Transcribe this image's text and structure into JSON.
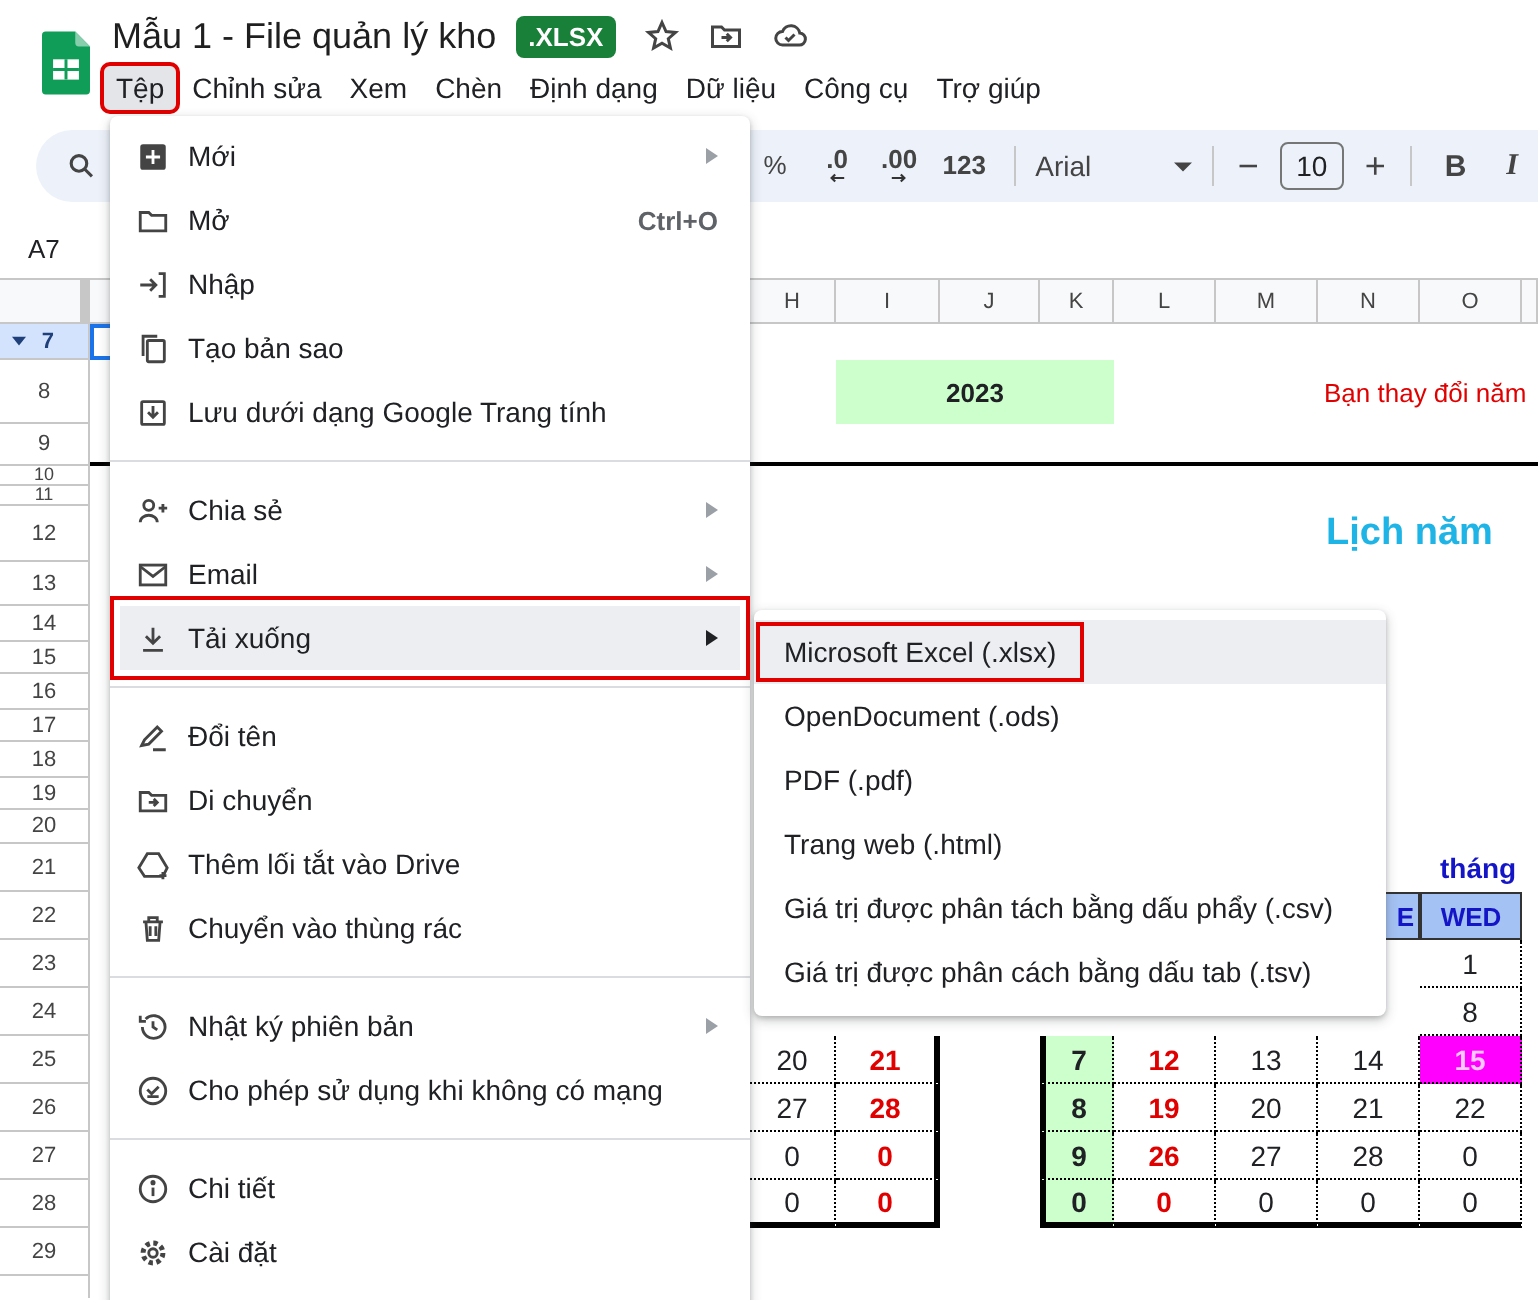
{
  "document": {
    "title": "Mẫu 1 - File quản lý kho",
    "badge": ".XLSX"
  },
  "menu_bar": [
    {
      "label": "Tệp",
      "selected": true,
      "annotated": true
    },
    {
      "label": "Chỉnh sửa",
      "selected": false,
      "annotated": false
    },
    {
      "label": "Xem",
      "selected": false,
      "annotated": false
    },
    {
      "label": "Chèn",
      "selected": false,
      "annotated": false
    },
    {
      "label": "Định dạng",
      "selected": false,
      "annotated": false
    },
    {
      "label": "Dữ liệu",
      "selected": false,
      "annotated": false
    },
    {
      "label": "Công cụ",
      "selected": false,
      "annotated": false
    },
    {
      "label": "Trợ giúp",
      "selected": false,
      "annotated": false
    }
  ],
  "toolbar": {
    "format_buttons": [
      "%",
      ".0",
      ".00",
      "123"
    ],
    "font": "Arial",
    "decrease": "−",
    "font_size": "10",
    "increase": "+",
    "style_buttons": [
      "B",
      "I"
    ]
  },
  "name_box": "A7",
  "sheet": {
    "columns": [
      "H",
      "I",
      "J",
      "K",
      "L",
      "M",
      "N",
      "O"
    ],
    "rows": [
      {
        "number": "7",
        "selected": true
      },
      {
        "number": "8",
        "selected": false
      },
      {
        "number": "9",
        "selected": false
      },
      {
        "number": "10",
        "selected": false
      },
      {
        "number": "11",
        "selected": false
      },
      {
        "number": "12",
        "selected": false
      },
      {
        "number": "13",
        "selected": false
      },
      {
        "number": "14",
        "selected": false
      },
      {
        "number": "15",
        "selected": false
      },
      {
        "number": "16",
        "selected": false
      },
      {
        "number": "17",
        "selected": false
      },
      {
        "number": "18",
        "selected": false
      },
      {
        "number": "19",
        "selected": false
      },
      {
        "number": "20",
        "selected": false
      },
      {
        "number": "21",
        "selected": false
      },
      {
        "number": "22",
        "selected": false
      },
      {
        "number": "23",
        "selected": false
      },
      {
        "number": "24",
        "selected": false
      },
      {
        "number": "25",
        "selected": false
      },
      {
        "number": "26",
        "selected": false
      },
      {
        "number": "27",
        "selected": false
      },
      {
        "number": "28",
        "selected": false
      },
      {
        "number": "29",
        "selected": false
      }
    ],
    "year": "2023",
    "note": "Bạn thay đổi năm",
    "calendar_title": "Lịch năm",
    "month_label": "tháng",
    "calendar_left": [
      [
        {
          "text": "20",
          "kind": "day"
        },
        {
          "text": "21",
          "kind": "sunday"
        }
      ],
      [
        {
          "text": "27",
          "kind": "day"
        },
        {
          "text": "28",
          "kind": "sunday"
        }
      ],
      [
        {
          "text": "0",
          "kind": "day"
        },
        {
          "text": "0",
          "kind": "sunday"
        }
      ],
      [
        {
          "text": "0",
          "kind": "day"
        },
        {
          "text": "0",
          "kind": "sunday"
        }
      ]
    ],
    "calendar_right": {
      "header": [
        "E",
        "WED"
      ],
      "rows": [
        [
          {
            "text": "1",
            "kind": "day"
          }
        ],
        [
          {
            "text": "8",
            "kind": "day"
          }
        ],
        [
          {
            "text": "7",
            "kind": "week"
          },
          {
            "text": "12",
            "kind": "sunday"
          },
          {
            "text": "13",
            "kind": "day"
          },
          {
            "text": "14",
            "kind": "day"
          },
          {
            "text": "15",
            "kind": "today"
          }
        ],
        [
          {
            "text": "8",
            "kind": "week"
          },
          {
            "text": "19",
            "kind": "sunday"
          },
          {
            "text": "20",
            "kind": "day"
          },
          {
            "text": "21",
            "kind": "day"
          },
          {
            "text": "22",
            "kind": "day"
          }
        ],
        [
          {
            "text": "9",
            "kind": "week"
          },
          {
            "text": "26",
            "kind": "sunday"
          },
          {
            "text": "27",
            "kind": "day"
          },
          {
            "text": "28",
            "kind": "day"
          },
          {
            "text": "0",
            "kind": "day"
          }
        ],
        [
          {
            "text": "0",
            "kind": "week"
          },
          {
            "text": "0",
            "kind": "sunday"
          },
          {
            "text": "0",
            "kind": "day"
          },
          {
            "text": "0",
            "kind": "day"
          },
          {
            "text": "0",
            "kind": "day"
          }
        ]
      ]
    }
  },
  "file_menu": [
    [
      {
        "label": "Mới",
        "has_submenu": true,
        "selected": false,
        "annotated": false
      },
      {
        "label": "Mở",
        "shortcut": "Ctrl+O",
        "has_submenu": false,
        "selected": false,
        "annotated": false
      },
      {
        "label": "Nhập",
        "has_submenu": false,
        "selected": false,
        "annotated": false
      },
      {
        "label": "Tạo bản sao",
        "has_submenu": false,
        "selected": false,
        "annotated": false
      },
      {
        "label": "Lưu dưới dạng Google Trang tính",
        "has_submenu": false,
        "selected": false,
        "annotated": false
      }
    ],
    [
      {
        "label": "Chia sẻ",
        "has_submenu": true,
        "selected": false,
        "annotated": false
      },
      {
        "label": "Email",
        "has_submenu": true,
        "selected": false,
        "annotated": false
      },
      {
        "label": "Tải xuống",
        "has_submenu": true,
        "selected": true,
        "annotated": true
      }
    ],
    [
      {
        "label": "Đổi tên",
        "has_submenu": false,
        "selected": false,
        "annotated": false
      },
      {
        "label": "Di chuyển",
        "has_submenu": false,
        "selected": false,
        "annotated": false
      },
      {
        "label": "Thêm lối tắt vào Drive",
        "has_submenu": false,
        "selected": false,
        "annotated": false
      },
      {
        "label": "Chuyển vào thùng rác",
        "has_submenu": false,
        "selected": false,
        "annotated": false
      }
    ],
    [
      {
        "label": "Nhật ký phiên bản",
        "has_submenu": true,
        "selected": false,
        "annotated": false
      },
      {
        "label": "Cho phép sử dụng khi không có mạng",
        "has_submenu": false,
        "selected": false,
        "annotated": false
      }
    ],
    [
      {
        "label": "Chi tiết",
        "has_submenu": false,
        "selected": false,
        "annotated": false
      },
      {
        "label": "Cài đặt",
        "has_submenu": false,
        "selected": false,
        "annotated": false
      }
    ]
  ],
  "download_menu": [
    {
      "label": "Microsoft Excel (.xlsx)",
      "selected": true,
      "annotated": true
    },
    {
      "label": "OpenDocument (.ods)",
      "selected": false,
      "annotated": false
    },
    {
      "label": "PDF (.pdf)",
      "selected": false,
      "annotated": false
    },
    {
      "label": "Trang web (.html)",
      "selected": false,
      "annotated": false
    },
    {
      "label": "Giá trị được phân tách bằng dấu phẩy (.csv)",
      "selected": false,
      "annotated": false
    },
    {
      "label": "Giá trị được phân cách bằng dấu tab (.tsv)",
      "selected": false,
      "annotated": false
    }
  ]
}
